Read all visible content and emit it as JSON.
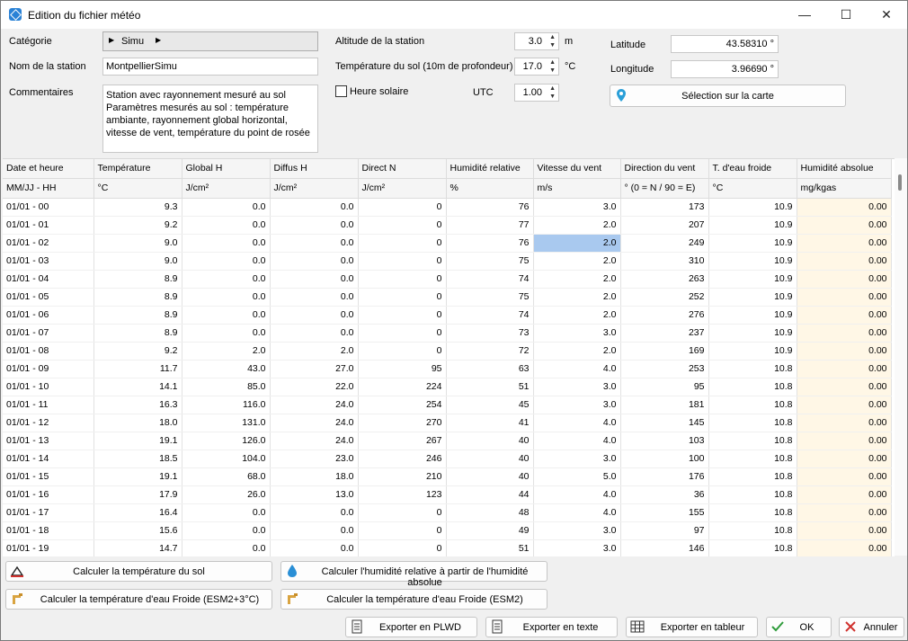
{
  "window": {
    "title": "Edition du fichier météo"
  },
  "form": {
    "category_label": "Catégorie",
    "category_value": "Simu",
    "station_name_label": "Nom de la station",
    "station_name_value": "MontpellierSimu",
    "comments_label": "Commentaires",
    "comments_value": "Station avec rayonnement mesuré au sol Paramètres mesurés au sol : température ambiante, rayonnement global horizontal, vitesse de vent, température du point de rosée",
    "altitude_label": "Altitude de la station",
    "altitude_value": "3.0",
    "altitude_unit": "m",
    "soil_temp_label": "Température du sol (10m de profondeur)",
    "soil_temp_value": "17.0",
    "soil_temp_unit": "°C",
    "solar_time_label": "Heure solaire",
    "solar_time_checked": false,
    "utc_label": "UTC",
    "utc_value": "1.00",
    "latitude_label": "Latitude",
    "latitude_value": "43.58310 °",
    "longitude_label": "Longitude",
    "longitude_value": "3.96690 °",
    "map_button": "Sélection sur la carte"
  },
  "table": {
    "headers": [
      "Date et heure",
      "Température",
      "Global H",
      "Diffus H",
      "Direct N",
      "Humidité relative",
      "Vitesse du vent",
      "Direction du vent",
      "T. d'eau froide",
      "Humidité absolue"
    ],
    "units": [
      "MM/JJ - HH",
      "°C",
      "J/cm²",
      "J/cm²",
      "J/cm²",
      "%",
      "m/s",
      "° (0 = N / 90 = E)",
      "°C",
      "mg/kgas"
    ],
    "rows": [
      [
        "01/01 - 00",
        "9.3",
        "0.0",
        "0.0",
        "0",
        "76",
        "3.0",
        "173",
        "10.9",
        "0.00"
      ],
      [
        "01/01 - 01",
        "9.2",
        "0.0",
        "0.0",
        "0",
        "77",
        "2.0",
        "207",
        "10.9",
        "0.00"
      ],
      [
        "01/01 - 02",
        "9.0",
        "0.0",
        "0.0",
        "0",
        "76",
        "2.0",
        "249",
        "10.9",
        "0.00"
      ],
      [
        "01/01 - 03",
        "9.0",
        "0.0",
        "0.0",
        "0",
        "75",
        "2.0",
        "310",
        "10.9",
        "0.00"
      ],
      [
        "01/01 - 04",
        "8.9",
        "0.0",
        "0.0",
        "0",
        "74",
        "2.0",
        "263",
        "10.9",
        "0.00"
      ],
      [
        "01/01 - 05",
        "8.9",
        "0.0",
        "0.0",
        "0",
        "75",
        "2.0",
        "252",
        "10.9",
        "0.00"
      ],
      [
        "01/01 - 06",
        "8.9",
        "0.0",
        "0.0",
        "0",
        "74",
        "2.0",
        "276",
        "10.9",
        "0.00"
      ],
      [
        "01/01 - 07",
        "8.9",
        "0.0",
        "0.0",
        "0",
        "73",
        "3.0",
        "237",
        "10.9",
        "0.00"
      ],
      [
        "01/01 - 08",
        "9.2",
        "2.0",
        "2.0",
        "0",
        "72",
        "2.0",
        "169",
        "10.9",
        "0.00"
      ],
      [
        "01/01 - 09",
        "11.7",
        "43.0",
        "27.0",
        "95",
        "63",
        "4.0",
        "253",
        "10.8",
        "0.00"
      ],
      [
        "01/01 - 10",
        "14.1",
        "85.0",
        "22.0",
        "224",
        "51",
        "3.0",
        "95",
        "10.8",
        "0.00"
      ],
      [
        "01/01 - 11",
        "16.3",
        "116.0",
        "24.0",
        "254",
        "45",
        "3.0",
        "181",
        "10.8",
        "0.00"
      ],
      [
        "01/01 - 12",
        "18.0",
        "131.0",
        "24.0",
        "270",
        "41",
        "4.0",
        "145",
        "10.8",
        "0.00"
      ],
      [
        "01/01 - 13",
        "19.1",
        "126.0",
        "24.0",
        "267",
        "40",
        "4.0",
        "103",
        "10.8",
        "0.00"
      ],
      [
        "01/01 - 14",
        "18.5",
        "104.0",
        "23.0",
        "246",
        "40",
        "3.0",
        "100",
        "10.8",
        "0.00"
      ],
      [
        "01/01 - 15",
        "19.1",
        "68.0",
        "18.0",
        "210",
        "40",
        "5.0",
        "176",
        "10.8",
        "0.00"
      ],
      [
        "01/01 - 16",
        "17.9",
        "26.0",
        "13.0",
        "123",
        "44",
        "4.0",
        "36",
        "10.8",
        "0.00"
      ],
      [
        "01/01 - 17",
        "16.4",
        "0.0",
        "0.0",
        "0",
        "48",
        "4.0",
        "155",
        "10.8",
        "0.00"
      ],
      [
        "01/01 - 18",
        "15.6",
        "0.0",
        "0.0",
        "0",
        "49",
        "3.0",
        "97",
        "10.8",
        "0.00"
      ],
      [
        "01/01 - 19",
        "14.7",
        "0.0",
        "0.0",
        "0",
        "51",
        "3.0",
        "146",
        "10.8",
        "0.00"
      ]
    ],
    "selected_cell": {
      "row": 2,
      "col": 6
    }
  },
  "actions": {
    "soil_temp_button": "Calculer la température du sol",
    "rel_humidity_button": "Calculer l'humidité relative à partir de l'humidité absolue",
    "cold_water_esm2_plus_button": "Calculer la température d'eau Froide (ESM2+3°C)",
    "cold_water_esm2_button": "Calculer la température d'eau Froide (ESM2)",
    "export_plwd_button": "Exporter en PLWD",
    "export_text_button": "Exporter en texte",
    "export_sheet_button": "Exporter en tableur",
    "ok_button": "OK",
    "cancel_button": "Annuler"
  },
  "colors": {
    "selection": "#a9c9ef",
    "last_column_bg": "#fff7e6",
    "accent": "#2a82d6",
    "ok_green": "#2e9b3a",
    "cancel_red": "#d0312d"
  },
  "icons": [
    "app-icon",
    "minimize-icon",
    "maximize-icon",
    "close-icon",
    "map-pin-icon",
    "soil-temp-icon",
    "water-drop-icon",
    "faucet-icon",
    "document-icon",
    "spreadsheet-icon",
    "checkmark-icon",
    "cross-icon"
  ]
}
